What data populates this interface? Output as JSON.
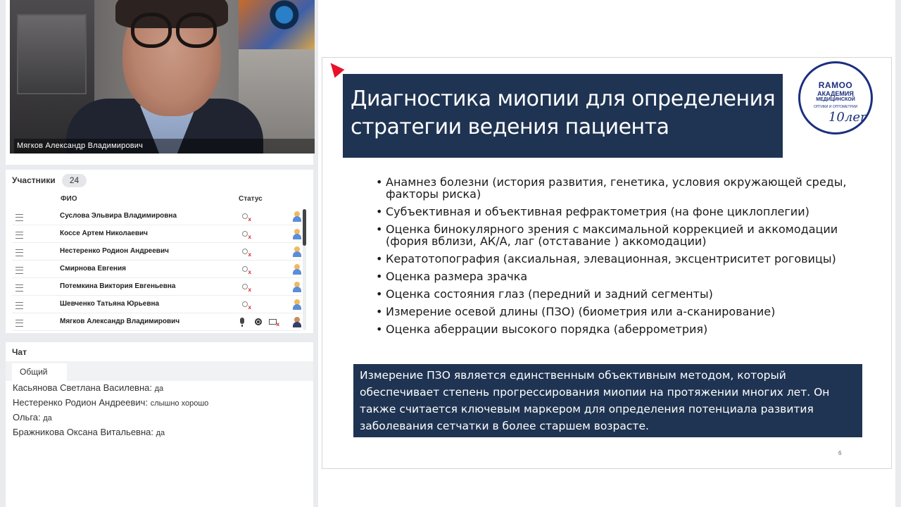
{
  "video": {
    "speaker_name": "Мягков  Александр  Владимирович"
  },
  "participants": {
    "title": "Участники",
    "count": "24",
    "col_name": "ФИО",
    "col_status": "Статус",
    "rows": [
      {
        "name": "Суслова Эльвира  Владимировна"
      },
      {
        "name": "Коссе Артем  Николаевич"
      },
      {
        "name": "Нестеренко Родион Андреевич"
      },
      {
        "name": "Смирнова Евгения"
      },
      {
        "name": "Потемкина Виктория  Евгеньевна"
      },
      {
        "name": "Шевченко Татьяна  Юрьевна"
      },
      {
        "name": "Мягков  Александр  Владимирович"
      }
    ]
  },
  "chat": {
    "title": "Чат",
    "tab": "Общий",
    "messages": [
      {
        "author": "Касьянова Светлана  Василевна:",
        "text": "да"
      },
      {
        "author": "Нестеренко Родион Андреевич:",
        "text": "слышно хорошо"
      },
      {
        "author": "Ольга:",
        "text": "да"
      },
      {
        "author": "Бражникова Оксана  Витальевна:",
        "text": "да"
      }
    ]
  },
  "slide": {
    "title": "Диагностика миопии для определения стратегии ведения пациента",
    "logo": {
      "line1": "RAMOO",
      "line2": "АКАДЕМИЯ",
      "line3": "МЕДИЦИНСКОЙ",
      "line4": "ОПТИКИ И ОПТОМЕТРИИ",
      "line5": "10лет"
    },
    "bullets": [
      "Анамнез болезни (история развития, генетика, условия окружающей среды, факторы риска)",
      "Субъективная и объективная рефрактометрия (на фоне циклоплегии)",
      "Оценка бинокулярного зрения с максимальной коррекцией и аккомодации (фория вблизи, АК/А, лаг (отставание ) аккомодации)",
      "Кератотопография (аксиальная, элевационная, эксцентриситет роговицы)",
      "Оценка размера зрачка",
      "Оценка состояния глаз (передний и задний сегменты)",
      "Измерение осевой длины (ПЗО) (биометрия или а-сканирование)",
      "Оценка аберрации высокого порядка  (аберрометрия)"
    ],
    "info": "Измерение ПЗО является единственным объективным методом, который обеспечивает степень  прогрессирования миопии на протяжении многих лет. Он также считается ключевым маркером для определения потенциала развития заболевания сетчатки в более старшем возрасте.",
    "page_number": "6"
  },
  "colors": {
    "slide_navy": "#1f3452",
    "pointer_red": "#e8102a",
    "logo_blue": "#1b2f7e"
  }
}
